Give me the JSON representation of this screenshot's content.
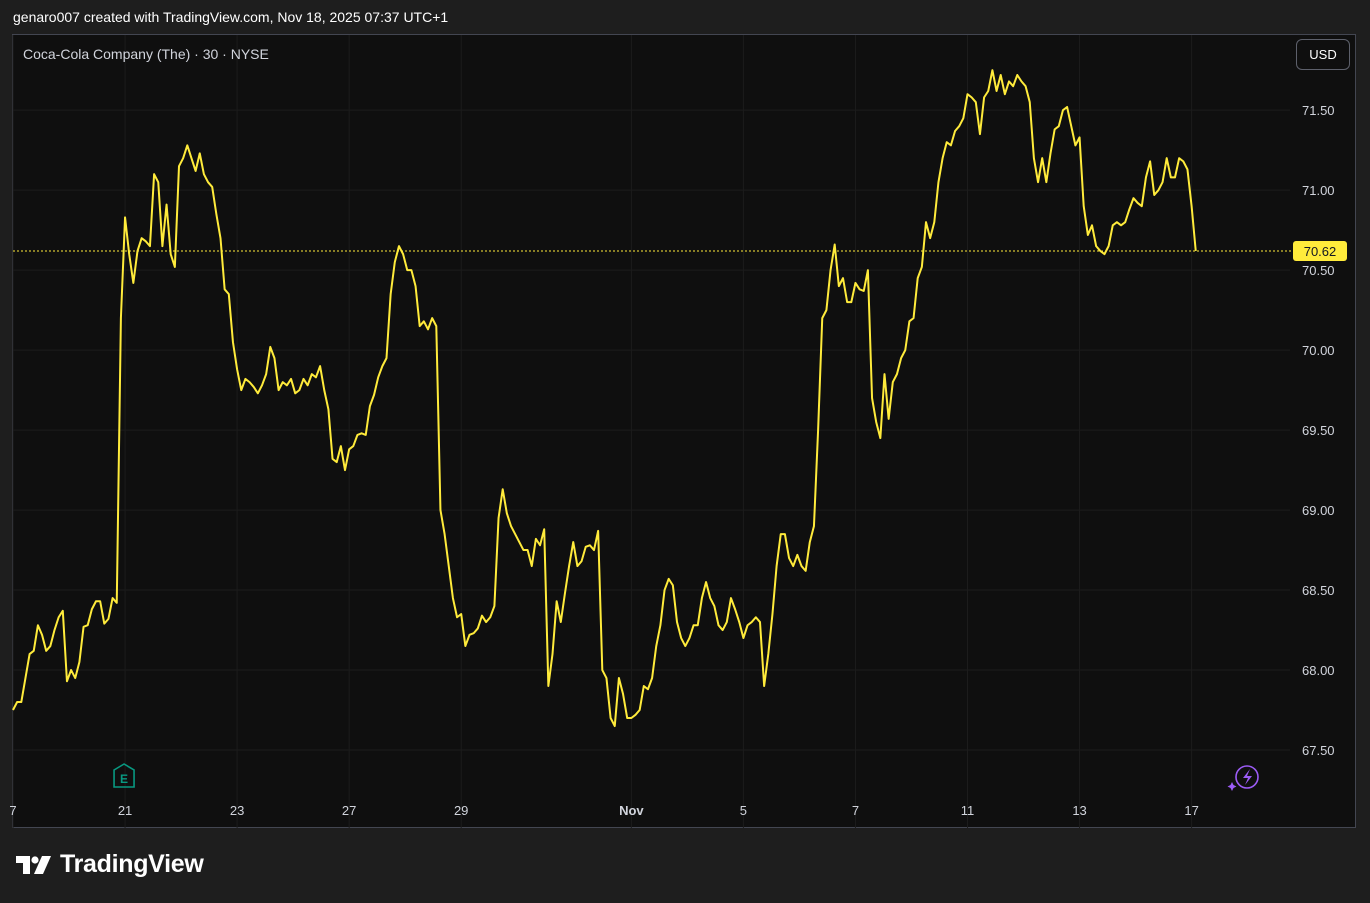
{
  "header": {
    "caption": "genaro007 created with TradingView.com, Nov 18, 2025 07:37 UTC+1"
  },
  "chart_header": {
    "symbol": "Coca-Cola Company (The) · 30 · NYSE",
    "currency_button": "USD"
  },
  "footer": {
    "brand": "TradingView"
  },
  "markers": {
    "earnings": "E"
  },
  "colors": {
    "line": "#ffeb3b",
    "background": "#0f0f0f",
    "grid": "#1c1c1c",
    "axis_text": "#d1d4dc",
    "earnings": "#089981",
    "alert": "#9c5cf6"
  },
  "icons": {
    "earnings": "earnings-marker-icon",
    "alert": "lightning-icon",
    "logo": "tradingview-logo-icon"
  },
  "chart_data": {
    "type": "line",
    "title": "",
    "xlabel": "",
    "ylabel": "",
    "ylim": [
      67.25,
      71.97
    ],
    "y_ticks": [
      67.5,
      68.0,
      68.5,
      69.0,
      69.5,
      70.0,
      70.5,
      71.0,
      71.5
    ],
    "y_tick_labels": [
      "67.50",
      "68.00",
      "68.50",
      "69.00",
      "69.50",
      "70.00",
      "70.50",
      "71.00",
      "71.50"
    ],
    "x_ticks": [
      {
        "label": "7",
        "i": 0
      },
      {
        "label": "21",
        "i": 27
      },
      {
        "label": "23",
        "i": 54
      },
      {
        "label": "27",
        "i": 81
      },
      {
        "label": "29",
        "i": 108
      },
      {
        "label": "Nov",
        "i": 149
      },
      {
        "label": "5",
        "i": 176
      },
      {
        "label": "7",
        "i": 203
      },
      {
        "label": "11",
        "i": 230
      },
      {
        "label": "13",
        "i": 257
      },
      {
        "label": "17",
        "i": 284
      }
    ],
    "last_price": 70.62,
    "last_price_label": "70.62",
    "earnings_index": 27,
    "series": [
      {
        "values": [
          67.75,
          67.8,
          67.8,
          67.95,
          68.1,
          68.12,
          68.28,
          68.22,
          68.12,
          68.15,
          68.25,
          68.33,
          68.37,
          67.93,
          68.0,
          67.95,
          68.05,
          68.27,
          68.28,
          68.38,
          68.43,
          68.43,
          68.29,
          68.32,
          68.45,
          68.42,
          70.2,
          70.83,
          70.6,
          70.42,
          70.62,
          70.7,
          70.68,
          70.65,
          71.1,
          71.05,
          70.65,
          70.91,
          70.6,
          70.52,
          71.15,
          71.2,
          71.28,
          71.2,
          71.12,
          71.23,
          71.1,
          71.05,
          71.02,
          70.85,
          70.7,
          70.38,
          70.35,
          70.05,
          69.88,
          69.75,
          69.82,
          69.8,
          69.77,
          69.73,
          69.78,
          69.85,
          70.02,
          69.95,
          69.75,
          69.8,
          69.78,
          69.82,
          69.73,
          69.75,
          69.82,
          69.78,
          69.85,
          69.83,
          69.9,
          69.75,
          69.63,
          69.32,
          69.3,
          69.4,
          69.25,
          69.38,
          69.4,
          69.47,
          69.48,
          69.47,
          69.65,
          69.72,
          69.83,
          69.9,
          69.95,
          70.35,
          70.55,
          70.65,
          70.6,
          70.5,
          70.5,
          70.4,
          70.15,
          70.18,
          70.13,
          70.2,
          70.15,
          69.0,
          68.85,
          68.65,
          68.45,
          68.33,
          68.35,
          68.15,
          68.22,
          68.23,
          68.26,
          68.34,
          68.3,
          68.33,
          68.4,
          68.95,
          69.13,
          68.98,
          68.9,
          68.85,
          68.8,
          68.75,
          68.75,
          68.65,
          68.82,
          68.78,
          68.88,
          67.9,
          68.1,
          68.43,
          68.3,
          68.48,
          68.65,
          68.8,
          68.65,
          68.68,
          68.77,
          68.78,
          68.75,
          68.87,
          68.0,
          67.95,
          67.7,
          67.65,
          67.95,
          67.85,
          67.7,
          67.7,
          67.72,
          67.75,
          67.9,
          67.88,
          67.95,
          68.15,
          68.28,
          68.5,
          68.57,
          68.53,
          68.3,
          68.2,
          68.15,
          68.2,
          68.28,
          68.28,
          68.45,
          68.55,
          68.45,
          68.4,
          68.28,
          68.25,
          68.3,
          68.45,
          68.38,
          68.3,
          68.2,
          68.28,
          68.3,
          68.33,
          68.3,
          67.9,
          68.1,
          68.35,
          68.65,
          68.85,
          68.85,
          68.7,
          68.65,
          68.72,
          68.65,
          68.62,
          68.8,
          68.9,
          69.5,
          70.2,
          70.25,
          70.5,
          70.66,
          70.4,
          70.45,
          70.3,
          70.3,
          70.42,
          70.38,
          70.37,
          70.5,
          69.7,
          69.55,
          69.45,
          69.85,
          69.57,
          69.8,
          69.85,
          69.95,
          70.0,
          70.18,
          70.2,
          70.45,
          70.52,
          70.8,
          70.7,
          70.8,
          71.05,
          71.2,
          71.3,
          71.28,
          71.37,
          71.4,
          71.45,
          71.6,
          71.58,
          71.55,
          71.35,
          71.58,
          71.62,
          71.75,
          71.62,
          71.72,
          71.6,
          71.68,
          71.65,
          71.72,
          71.68,
          71.65,
          71.55,
          71.2,
          71.05,
          71.2,
          71.05,
          71.23,
          71.38,
          71.4,
          71.5,
          71.52,
          71.4,
          71.28,
          71.33,
          70.9,
          70.72,
          70.78,
          70.65,
          70.62,
          70.6,
          70.65,
          70.78,
          70.8,
          70.78,
          70.8,
          70.88,
          70.95,
          70.92,
          70.9,
          71.08,
          71.18,
          70.97,
          71.0,
          71.05,
          71.2,
          71.08,
          71.08,
          71.2,
          71.18,
          71.13,
          70.9,
          70.62
        ]
      }
    ]
  }
}
